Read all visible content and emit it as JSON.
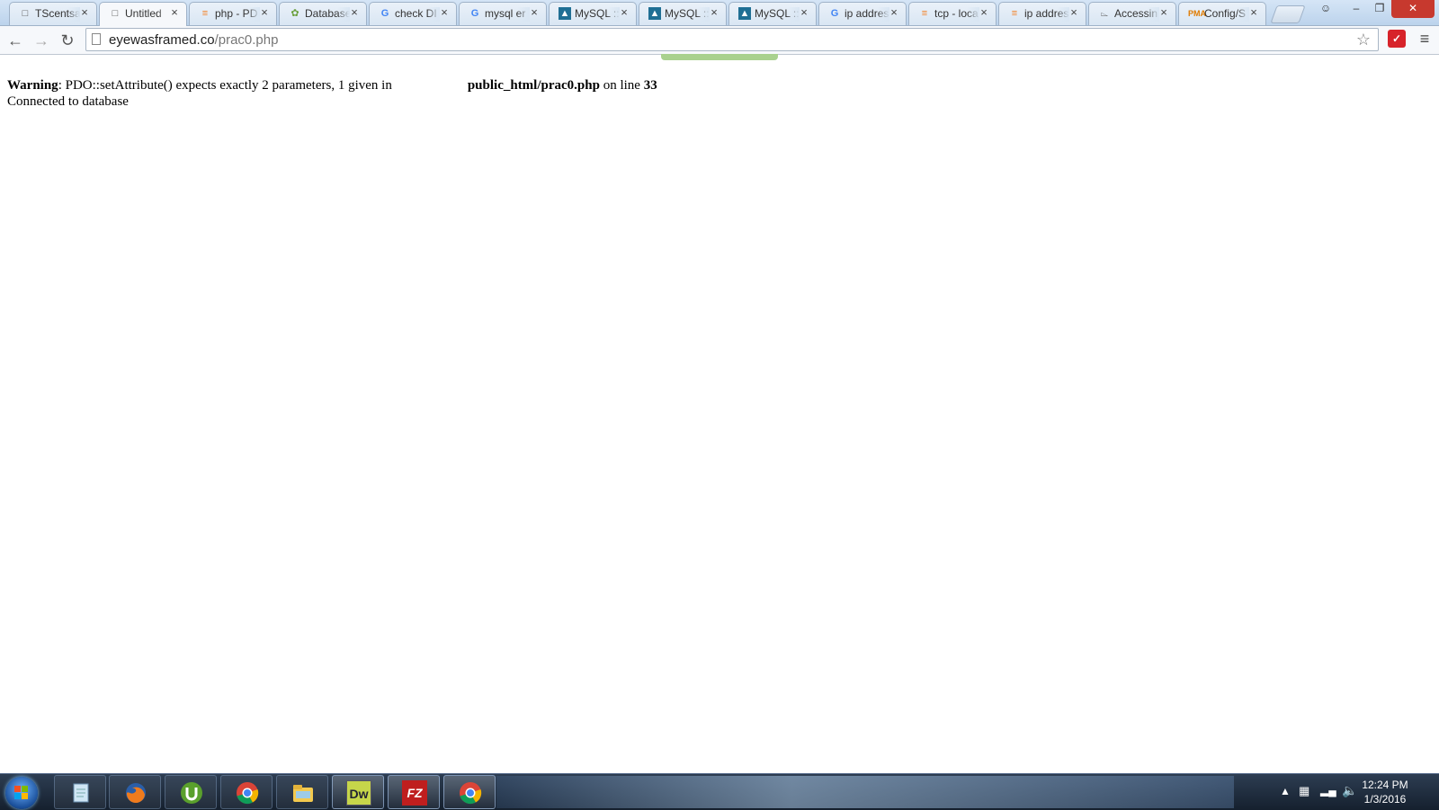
{
  "browser": {
    "tabs": [
      {
        "title": "TScentsa",
        "icon": "page-icon",
        "active": false
      },
      {
        "title": "Untitled",
        "icon": "page-icon",
        "active": true
      },
      {
        "title": "php - PD",
        "icon": "stackoverflow-icon",
        "active": false
      },
      {
        "title": "Database",
        "icon": "database-icon",
        "active": false
      },
      {
        "title": "check DI",
        "icon": "google-icon",
        "active": false
      },
      {
        "title": "mysql er",
        "icon": "google-icon",
        "active": false
      },
      {
        "title": "MySQL ::",
        "icon": "mysql-icon",
        "active": false
      },
      {
        "title": "MySQL ::",
        "icon": "mysql-icon",
        "active": false
      },
      {
        "title": "MySQL ::",
        "icon": "mysql-icon",
        "active": false
      },
      {
        "title": "ip addres",
        "icon": "google-icon",
        "active": false
      },
      {
        "title": "tcp - loca",
        "icon": "stackoverflow-icon",
        "active": false
      },
      {
        "title": "ip addres",
        "icon": "stackoverflow-icon",
        "active": false
      },
      {
        "title": "Accessin",
        "icon": "microphone-icon",
        "active": false
      },
      {
        "title": "Config/S",
        "icon": "phpmyadmin-icon",
        "active": false
      }
    ],
    "tab_close_glyph": "×",
    "window_controls": {
      "minimize": "–",
      "restore": "❐",
      "close": "✕"
    },
    "toolbar": {
      "back": "←",
      "forward": "→",
      "reload": "↻",
      "menu": "≡",
      "star": "☆",
      "extension": "✓"
    },
    "address": {
      "host": "eyewasframed.co",
      "path": "/prac0.php"
    }
  },
  "page": {
    "warning_label": "Warning",
    "warning_text": ": PDO::setAttribute() expects exactly 2 parameters, 1 given in",
    "file_path": "public_html/prac0.php",
    "on_line_text": " on line ",
    "line_number": "33",
    "status_line": "Connected to database"
  },
  "taskbar": {
    "apps": [
      {
        "name": "notepad",
        "state": "pinned"
      },
      {
        "name": "firefox",
        "state": "pinned"
      },
      {
        "name": "utorrent",
        "state": "pinned"
      },
      {
        "name": "chrome",
        "state": "pinned"
      },
      {
        "name": "file-explorer",
        "state": "pinned"
      },
      {
        "name": "dreamweaver",
        "state": "running",
        "label": "Dw"
      },
      {
        "name": "filezilla",
        "state": "running",
        "label": "FZ"
      },
      {
        "name": "chrome",
        "state": "running"
      }
    ],
    "clock_time": "12:24 PM",
    "clock_date": "1/3/2016"
  },
  "colors": {
    "loading_bar": "#a9d18e",
    "taskbar": "#1b2737",
    "extension_red": "#d7232a"
  }
}
